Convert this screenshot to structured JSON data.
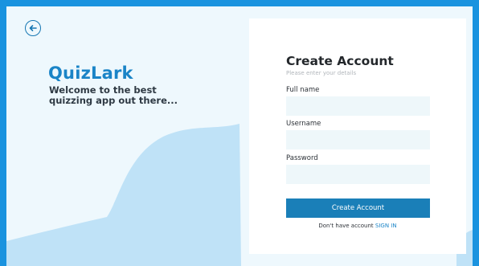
{
  "app": {
    "brand": "QuizLark",
    "tagline": "Welcome to the best quizzing app out there..."
  },
  "colors": {
    "outer_border": "#1a93df",
    "background": "#eef8fd",
    "wave": "#bfe2f7",
    "accent": "#1a84c7",
    "button": "#1a7fb8",
    "input_bg": "#eef7fa"
  },
  "icons": {
    "back": "arrow-left-circle-icon"
  },
  "form": {
    "title": "Create Account",
    "subtitle": "Please enter your details",
    "fields": [
      {
        "label": "Full name",
        "value": "",
        "placeholder": ""
      },
      {
        "label": "Username",
        "value": "",
        "placeholder": ""
      },
      {
        "label": "Password",
        "value": "",
        "placeholder": ""
      }
    ],
    "submit_label": "Create Account",
    "signin_prompt": "Don't have account",
    "signin_link": "SIGN IN"
  }
}
